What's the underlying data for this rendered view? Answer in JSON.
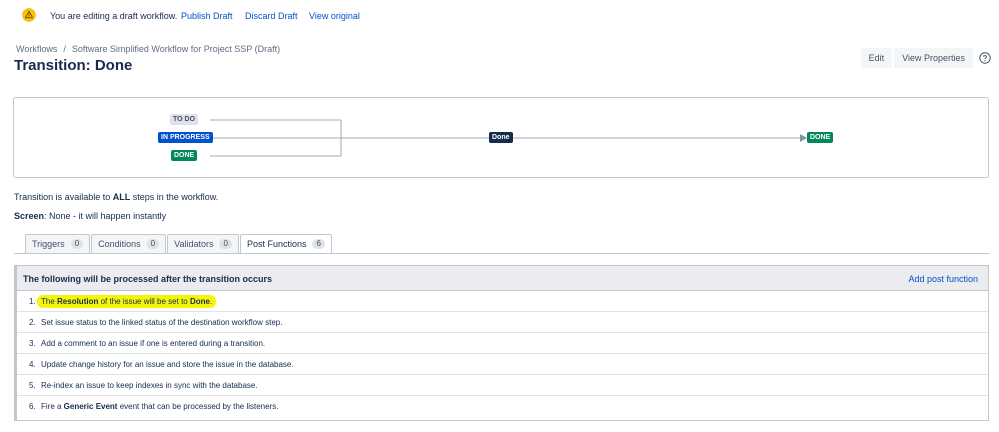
{
  "banner": {
    "message": "You are editing a draft workflow.",
    "publish_label": "Publish Draft",
    "discard_label": "Discard Draft",
    "view_original_label": "View original",
    "icon": "warning-icon"
  },
  "breadcrumb": {
    "root": "Workflows",
    "separator": "/",
    "current": "Software Simplified Workflow for Project SSP (Draft)"
  },
  "page_title": "Transition: Done",
  "toolbar": {
    "edit_label": "Edit",
    "view_properties_label": "View Properties",
    "help_icon": "help-icon"
  },
  "diagram": {
    "source_statuses": [
      {
        "label": "TO DO",
        "category": "todo"
      },
      {
        "label": "IN PROGRESS",
        "category": "inprogress"
      },
      {
        "label": "DONE",
        "category": "done"
      }
    ],
    "transition_label": "Done",
    "target_status": "DONE"
  },
  "availability": {
    "prefix": "Transition is available to ",
    "emphasis": "ALL",
    "suffix": " steps in the workflow."
  },
  "screen": {
    "label": "Screen",
    "value": ": None - it will happen instantly"
  },
  "tabs": [
    {
      "label": "Triggers",
      "count": "0"
    },
    {
      "label": "Conditions",
      "count": "0"
    },
    {
      "label": "Validators",
      "count": "0"
    },
    {
      "label": "Post Functions",
      "count": "6",
      "active": true
    }
  ],
  "post_functions": {
    "header": "The following will be processed after the transition occurs",
    "add_label": "Add post function",
    "items": [
      {
        "num": "1.",
        "parts": [
          "The ",
          "Resolution",
          " of the issue will be set to ",
          "Done",
          "."
        ],
        "highlighted": true
      },
      {
        "num": "2.",
        "text": "Set issue status to the linked status of the destination workflow step."
      },
      {
        "num": "3.",
        "text": "Add a comment to an issue if one is entered during a transition."
      },
      {
        "num": "4.",
        "text": "Update change history for an issue and store the issue in the database."
      },
      {
        "num": "5.",
        "text": "Re-index an issue to keep indexes in sync with the database."
      },
      {
        "num": "6.",
        "parts": [
          "Fire a ",
          "Generic Event",
          " event that can be processed by the listeners."
        ]
      }
    ]
  },
  "colors": {
    "link": "#0052cc",
    "highlight": "#f5f50a",
    "status_done": "#00875a",
    "status_inprogress": "#0052cc",
    "status_todo": "#dfe1e6"
  }
}
